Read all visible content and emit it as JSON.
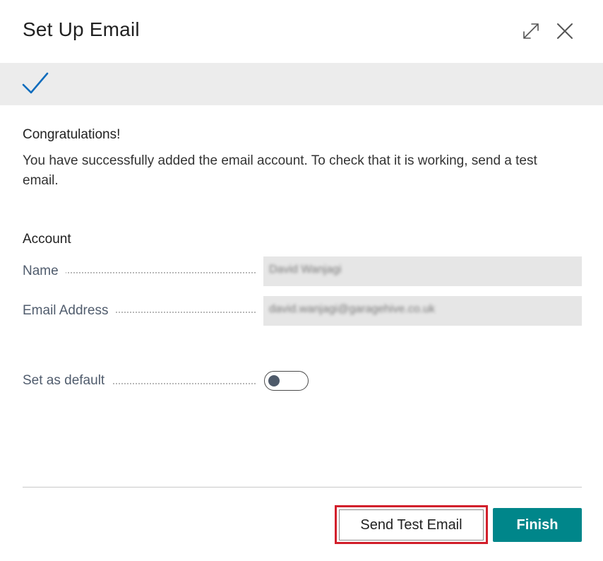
{
  "dialog": {
    "title": "Set Up Email"
  },
  "content": {
    "heading": "Congratulations!",
    "message": "You have successfully added the email account. To check that it is working, send a test email."
  },
  "account": {
    "section_title": "Account",
    "name_label": "Name",
    "name_value": "David Wanjagi",
    "email_label": "Email Address",
    "email_value": "david.wanjagi@garagehive.co.uk",
    "default_label": "Set as default",
    "default_on": false
  },
  "actions": {
    "send_test_label": "Send Test Email",
    "finish_label": "Finish"
  },
  "colors": {
    "accent": "#00868a",
    "check": "#0f6cbd",
    "highlight": "#d21f2b"
  }
}
